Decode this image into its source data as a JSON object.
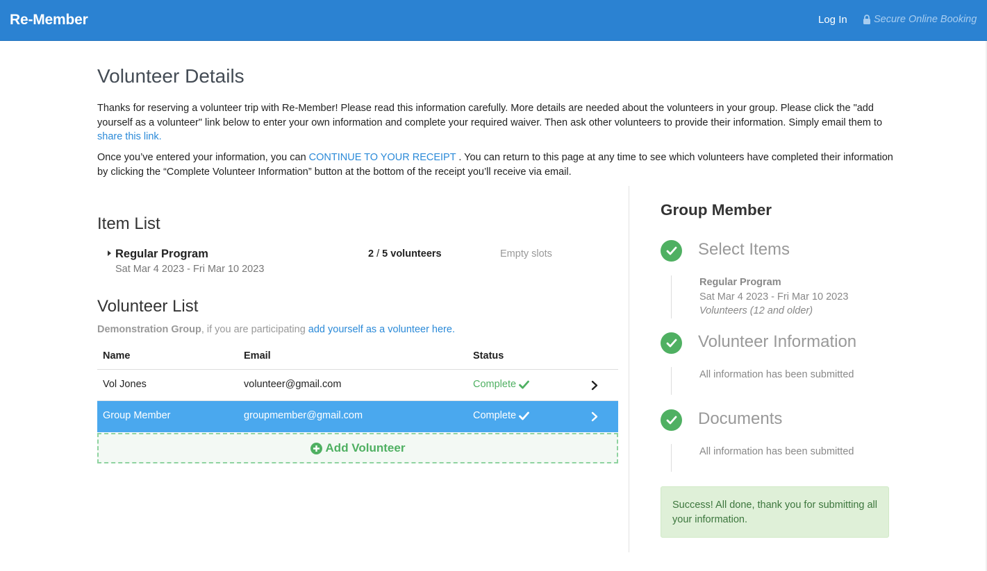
{
  "navbar": {
    "brand": "Re-Member",
    "login_label": "Log In",
    "secure_label": "Secure Online Booking",
    "secure_icon": "lock-icon"
  },
  "page": {
    "title": "Volunteer Details",
    "intro1_text": "Thanks for reserving a volunteer trip with Re-Member! Please read this information carefully. More details are needed about the volunteers in your group. Please click the \"add yourself as a volunteer\" link below to enter your own information and complete your required waiver. Then ask other volunteers to provide their information. Simply email them to ",
    "intro1_link": "share this link.",
    "intro2_pre": "Once you’ve entered your information, you can ",
    "intro2_link": "CONTINUE TO YOUR RECEIPT",
    "intro2_post": " . You can return to this page at any time to see which volunteers have completed their information by clicking the “Complete Volunteer Information” button at the bottom of the receipt you’ll receive via email."
  },
  "item_list": {
    "heading": "Item List",
    "program_name": "Regular Program",
    "program_dates": "Sat Mar 4 2023 - Fri Mar 10 2023",
    "vol_current": "2",
    "vol_sep": " / ",
    "vol_total": "5 volunteers",
    "empty_slots": "Empty slots"
  },
  "volunteer_list": {
    "heading": "Volunteer List",
    "group_name": "Demonstration Group",
    "group_mid": ", if you are participating ",
    "group_link": "add yourself as a volunteer here.",
    "columns": {
      "name": "Name",
      "email": "Email",
      "status": "Status"
    },
    "rows": [
      {
        "name": "Vol Jones",
        "email": "volunteer@gmail.com",
        "status": "Complete",
        "selected": false
      },
      {
        "name": "Group Member",
        "email": "groupmember@gmail.com",
        "status": "Complete",
        "selected": true
      }
    ],
    "add_label": "Add Volunteer"
  },
  "sidebar": {
    "heading": "Group Member",
    "steps": [
      {
        "title": "Select Items",
        "detail_name": "Regular Program",
        "detail_date": "Sat Mar 4 2023 - Fri Mar 10 2023",
        "detail_note": "Volunteers (12 and older)"
      },
      {
        "title": "Volunteer Information",
        "detail": "All information has been submitted"
      },
      {
        "title": "Documents",
        "detail": "All information has been submitted"
      }
    ],
    "success": "Success! All done, thank you for submitting all your information."
  },
  "colors": {
    "navbar": "#2b82d2",
    "link": "#2b8ad8",
    "success_green": "#4fb062",
    "selected_row": "#4aa8ee"
  }
}
